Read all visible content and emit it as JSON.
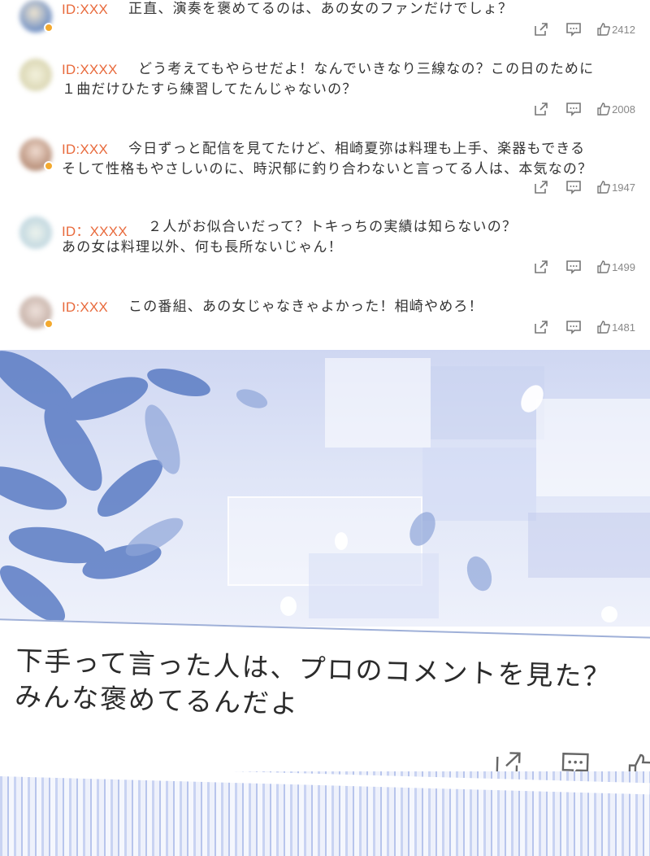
{
  "comments": [
    {
      "id": "ID:XXX",
      "lines": [
        "正直、演奏を褒めてるのは、あの女のファンだけでしょ？"
      ],
      "likes": "2412",
      "avatar_colors": [
        "#6f8fc4",
        "#f1e6d0"
      ]
    },
    {
      "id": "ID:XXXX",
      "lines": [
        "どう考えてもやらせだよ！なんでいきなり三線なの？この日のために",
        "１曲だけひたすら練習してたんじゃないの？"
      ],
      "likes": "2008",
      "avatar_colors": [
        "#e9e6c7",
        "#d8d4b0"
      ]
    },
    {
      "id": "ID:XXX",
      "lines": [
        "今日ずっと配信を見てたけど、相崎夏弥は料理も上手、楽器もできる",
        "そして性格もやさしいのに、時沢郁に釣り合わないと言ってる人は、本気なの？"
      ],
      "likes": "1947",
      "avatar_colors": [
        "#c69a82",
        "#f1ddd2"
      ]
    },
    {
      "id": "ID：XXXX",
      "lines": [
        "２人がお似合いだって？トキっちの実績は知らないの？",
        "あの女は料理以外、何も長所ないじゃん！"
      ],
      "likes": "1499",
      "avatar_colors": [
        "#c9dde6",
        "#e8f0e8"
      ]
    },
    {
      "id": "ID:XXX",
      "lines": [
        "この番組、あの女じゃなきゃよかった！相崎やめろ！"
      ],
      "likes": "1481",
      "avatar_colors": [
        "#cbb6ae",
        "#efe2dc"
      ]
    }
  ],
  "icons": {
    "share": "share-icon",
    "reply": "reply-icon",
    "like": "thumbs-up-icon"
  },
  "caption": {
    "lines": [
      "下手って言った人は、プロのコメントを見た？",
      "みんな褒めてるんだよ"
    ]
  },
  "colors": {
    "id_accent": "#e86a3c",
    "badge": "#f3a92f",
    "panel_sky": "#dfe5f7",
    "leaves": "#4a6fb8"
  }
}
